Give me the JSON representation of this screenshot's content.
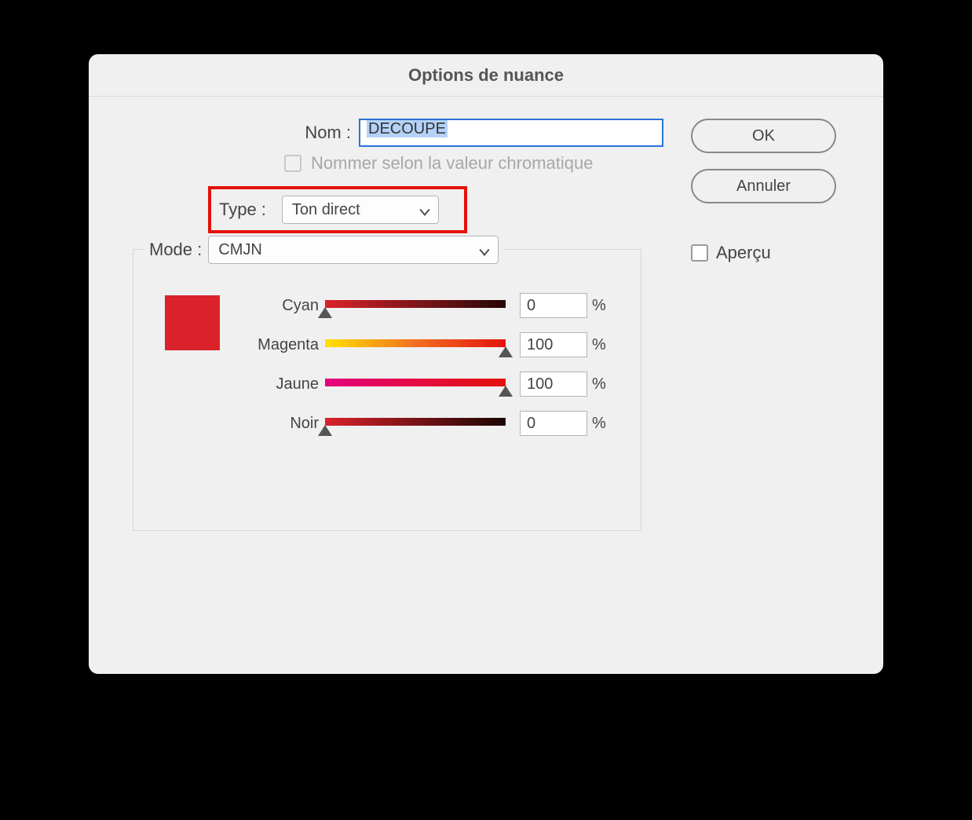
{
  "dialog": {
    "title": "Options de nuance"
  },
  "buttons": {
    "ok": "OK",
    "cancel": "Annuler"
  },
  "preview": {
    "label": "Aperçu",
    "checked": false
  },
  "name": {
    "label": "Nom :",
    "value": "DECOUPE"
  },
  "nameByChroma": {
    "label": "Nommer selon la valeur chromatique",
    "checked": false,
    "enabled": false
  },
  "type": {
    "label": "Type :",
    "value": "Ton direct"
  },
  "mode": {
    "label": "Mode :",
    "value": "CMJN"
  },
  "swatchColor": "#d9222a",
  "channels": [
    {
      "name": "Cyan",
      "value": 0,
      "unit": "%",
      "trackClass": "cyan"
    },
    {
      "name": "Magenta",
      "value": 100,
      "unit": "%",
      "trackClass": "magenta"
    },
    {
      "name": "Jaune",
      "value": 100,
      "unit": "%",
      "trackClass": "jaune"
    },
    {
      "name": "Noir",
      "value": 0,
      "unit": "%",
      "trackClass": "noir"
    }
  ]
}
